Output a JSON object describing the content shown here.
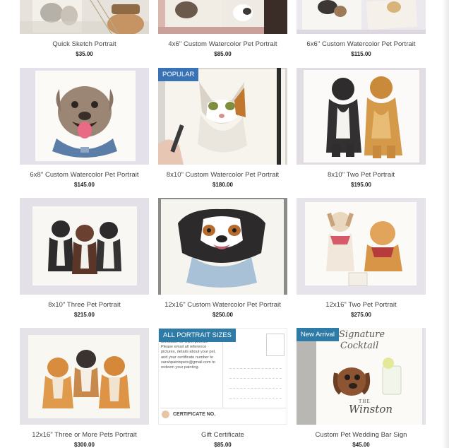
{
  "products": [
    {
      "name": "Quick Sketch Portrait",
      "price": "$35.00",
      "badge": ""
    },
    {
      "name": "4x6\" Custom Watercolor Pet Portrait",
      "price": "$85.00",
      "badge": ""
    },
    {
      "name": "6x6\" Custom Watercolor Pet Portrait",
      "price": "$115.00",
      "badge": ""
    },
    {
      "name": "6x8\" Custom Watercolor Pet Portrait",
      "price": "$145.00",
      "badge": ""
    },
    {
      "name": "8x10\" Custom Watercolor Pet Portrait",
      "price": "$180.00",
      "badge": "POPULAR"
    },
    {
      "name": "8x10\" Two Pet Portrait",
      "price": "$195.00",
      "badge": ""
    },
    {
      "name": "8x10\" Three Pet Portrait",
      "price": "$215.00",
      "badge": ""
    },
    {
      "name": "12x16\" Custom Watercolor Pet Portrait",
      "price": "$250.00",
      "badge": ""
    },
    {
      "name": "12x16\" Two Pet Portrait",
      "price": "$275.00",
      "badge": ""
    },
    {
      "name": "12x16\" Three or More Pets Portrait",
      "price": "$300.00",
      "badge": ""
    },
    {
      "name": "Gift Certificate",
      "price": "$85.00",
      "badge": "ALL PORTRAIT SIZES"
    },
    {
      "name": "Custom Pet Wedding Bar Sign",
      "price": "$45.00",
      "badge": "New Arrival"
    }
  ],
  "gift_card": {
    "text": "certificate for a pet portrait. Please email all reference pictures, details about your pet, and your certificate number to sarahpaintspets@gmail.com to redeem your painting.",
    "cert_label": "CERTIFICATE NO."
  },
  "bar_sign": {
    "line1": "Signature",
    "line2": "Cocktail",
    "line3": "THE",
    "line4": "Winston"
  },
  "colors": {
    "badge_blue": "#3a73b5",
    "badge_teal": "#2d7ba6"
  }
}
